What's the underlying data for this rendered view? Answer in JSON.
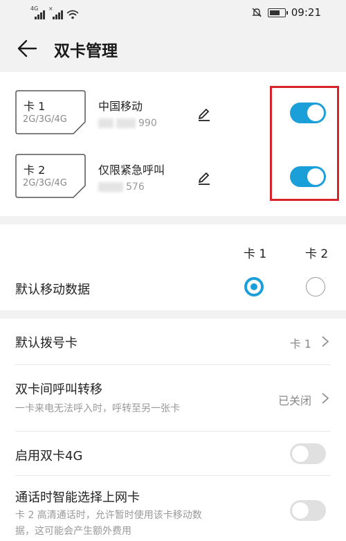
{
  "status_bar": {
    "sim1_tag": "4G",
    "sim2_tag": "×",
    "time": "09:21",
    "icons": [
      "signal-icon",
      "wifi-icon",
      "mute-icon",
      "battery-icon"
    ]
  },
  "header": {
    "title": "双卡管理",
    "back_icon": "back-arrow-icon"
  },
  "cards": [
    {
      "name": "卡 1",
      "network": "2G/3G/4G",
      "carrier": "中国移动",
      "number_suffix": "990",
      "enabled": true
    },
    {
      "name": "卡 2",
      "network": "2G/3G/4G",
      "carrier": "仅限紧急呼叫",
      "number_suffix": "576",
      "enabled": true
    }
  ],
  "default_data": {
    "col1": "卡 1",
    "col2": "卡 2",
    "label": "默认移动数据",
    "selected": "卡 1"
  },
  "settings": {
    "default_call_label": "默认拨号卡",
    "default_call_value": "卡 1",
    "call_forward_label": "双卡间呼叫转移",
    "call_forward_sub": "一卡来电无法呼入时，呼转至另一张卡",
    "call_forward_value": "已关闭",
    "dual_4g_label": "启用双卡4G",
    "dual_4g_enabled": false,
    "smart_select_label": "通话时智能选择上网卡",
    "smart_select_sub_1": "卡 2 高清通话时，允许暂时使用该卡移动数",
    "smart_select_sub_2": "据，这可能会产生额外费用",
    "smart_select_enabled": false
  },
  "colors": {
    "accent": "#1b9fd8",
    "highlight": "#d8232a",
    "background": "#f2f2f2"
  }
}
